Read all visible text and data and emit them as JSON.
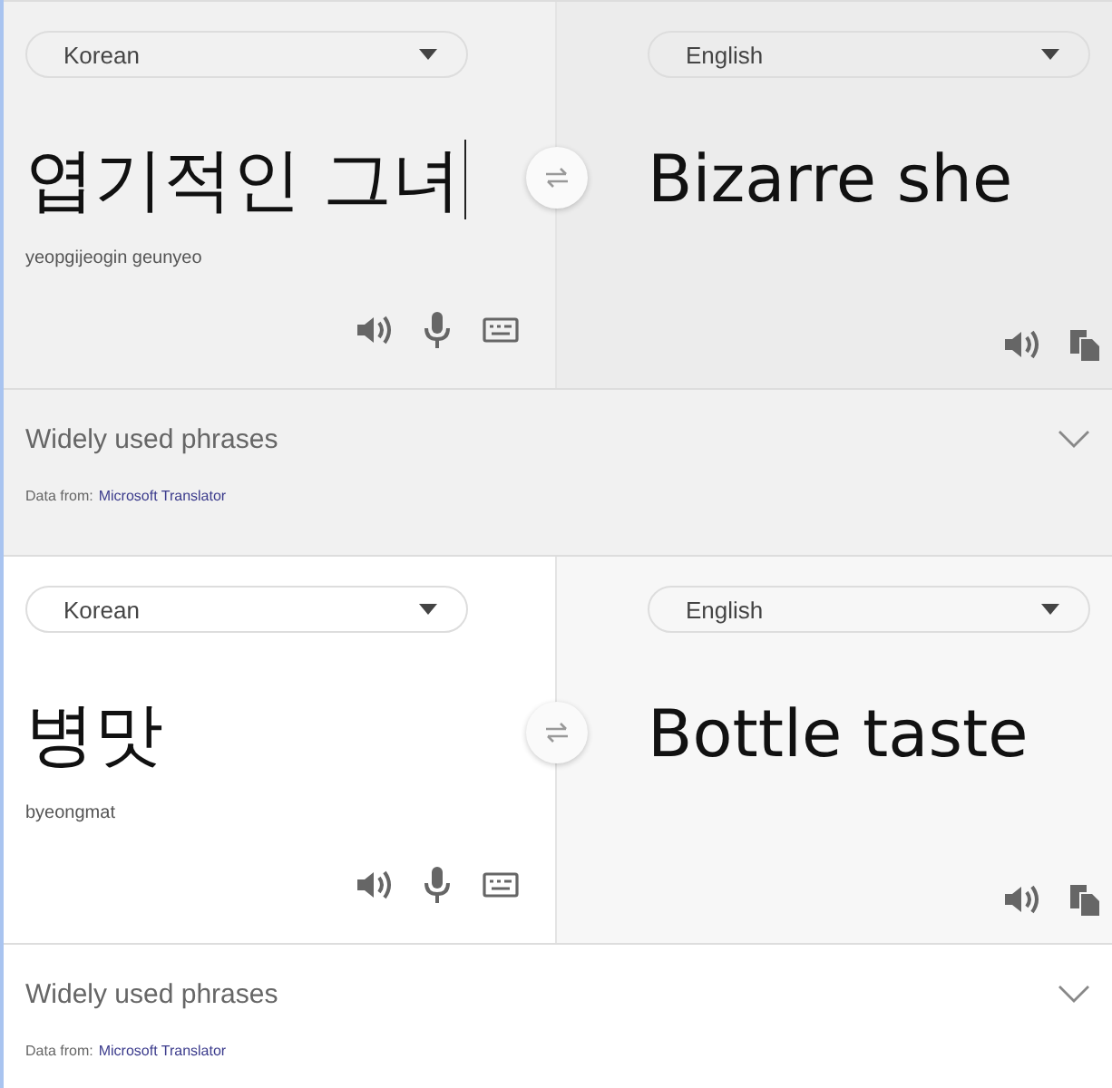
{
  "cards": [
    {
      "source": {
        "language": "Korean",
        "text": "엽기적인 그녀",
        "caret": true,
        "romanization": "yeopgijeogin geunyeo"
      },
      "target": {
        "language": "English",
        "text": "Bizarre she"
      },
      "phrases": {
        "label": "Widely used phrases",
        "expanded": false
      },
      "attribution": {
        "prefix": "Data from:",
        "link": "Microsoft Translator"
      }
    },
    {
      "source": {
        "language": "Korean",
        "text": "병맛",
        "caret": false,
        "romanization": "byeongmat"
      },
      "target": {
        "language": "English",
        "text": "Bottle taste"
      },
      "phrases": {
        "label": "Widely used phrases",
        "expanded": false
      },
      "attribution": {
        "prefix": "Data from:",
        "link": "Microsoft Translator"
      }
    }
  ]
}
